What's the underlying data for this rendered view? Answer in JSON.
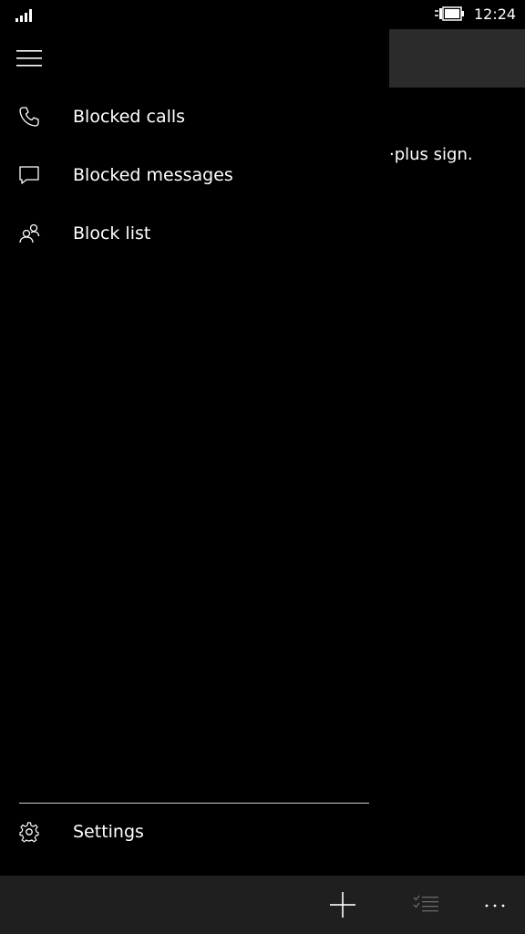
{
  "status_bar": {
    "time": "12:24",
    "signal_icon": "signal-icon",
    "battery_icon": "battery-charging-icon"
  },
  "background": {
    "hint_text": "·plus sign."
  },
  "nav": {
    "menu_icon": "hamburger-icon",
    "items": [
      {
        "label": "Blocked calls",
        "icon": "phone-icon"
      },
      {
        "label": "Blocked messages",
        "icon": "message-icon"
      },
      {
        "label": "Block list",
        "icon": "people-icon"
      }
    ],
    "footer_item": {
      "label": "Settings",
      "icon": "gear-icon"
    }
  },
  "app_bar": {
    "buttons": [
      {
        "icon": "add-icon",
        "enabled": true
      },
      {
        "icon": "select-list-icon",
        "enabled": false
      },
      {
        "icon": "more-icon",
        "enabled": true
      }
    ]
  },
  "colors": {
    "background": "#000000",
    "foreground": "#ffffff",
    "app_bar": "#1f1f1f",
    "disabled": "#6a6a6a"
  }
}
